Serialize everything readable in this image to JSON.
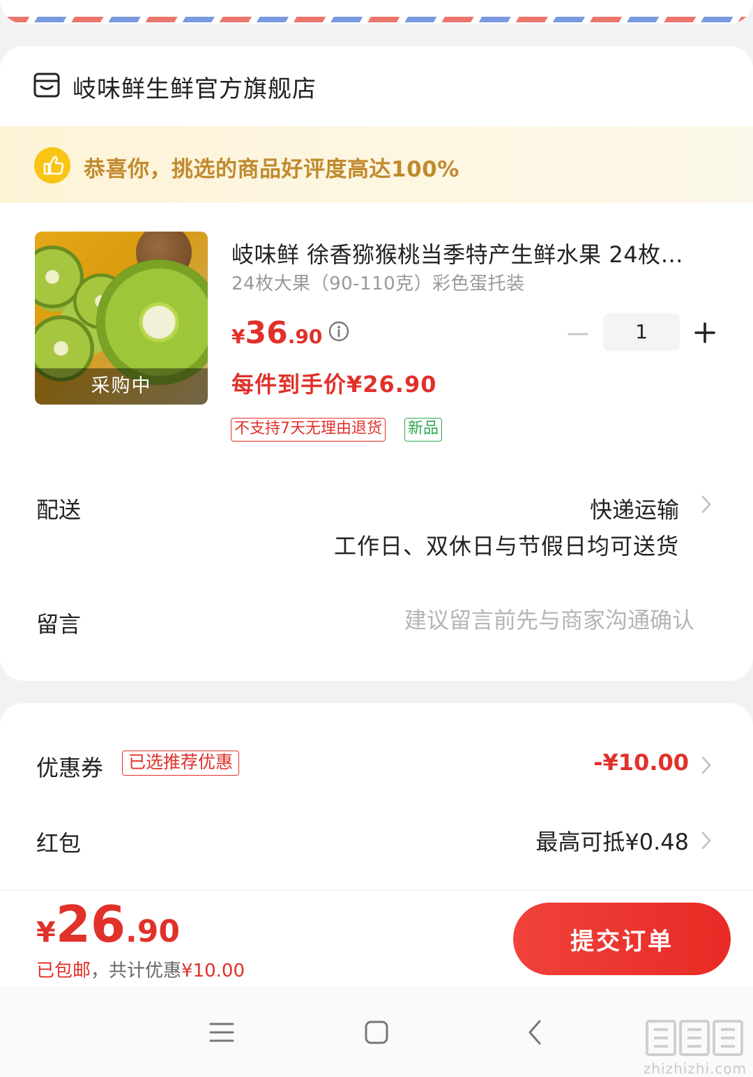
{
  "store": {
    "name": "岐味鲜生鲜官方旗舰店",
    "icon": "store-icon"
  },
  "praise": {
    "text": "恭喜你，挑选的商品好评度高达100%",
    "icon": "thumbs-up-icon"
  },
  "product": {
    "image_label": "采购中",
    "title": "岐味鲜 徐香猕猴桃当季特产生鲜水果 24枚大果（90-110克）彩色蛋托装",
    "spec": "24枚大果（90-110克）彩色蛋托装",
    "price_symbol": "¥",
    "price_int": "36",
    "price_dec": ".90",
    "quantity": "1",
    "hand_price": "每件到手价¥26.90",
    "tags": {
      "no_return": "不支持7天无理由退货",
      "new": "新品"
    }
  },
  "delivery": {
    "label": "配送",
    "value": "快递运输",
    "sub": "工作日、双休日与节假日均可送货"
  },
  "message": {
    "label": "留言",
    "placeholder": "建议留言前先与商家沟通确认"
  },
  "coupon": {
    "label": "优惠券",
    "tag": "已选推荐优惠",
    "value": "-¥10.00"
  },
  "red_packet": {
    "label": "红包",
    "value": "最高可抵¥0.48"
  },
  "footer": {
    "total_symbol": "¥",
    "total_int": "26",
    "total_dec": ".90",
    "shipped": "已包邮",
    "separator": "，共计优惠",
    "discount": "¥10.00",
    "submit": "提交订单"
  },
  "watermark": {
    "text": "zhizhizhi.com",
    "glyphs": "值值值"
  },
  "colors": {
    "accent": "#e0312a",
    "praise_text": "#c08a2e",
    "new_tag": "#2fa84f"
  }
}
